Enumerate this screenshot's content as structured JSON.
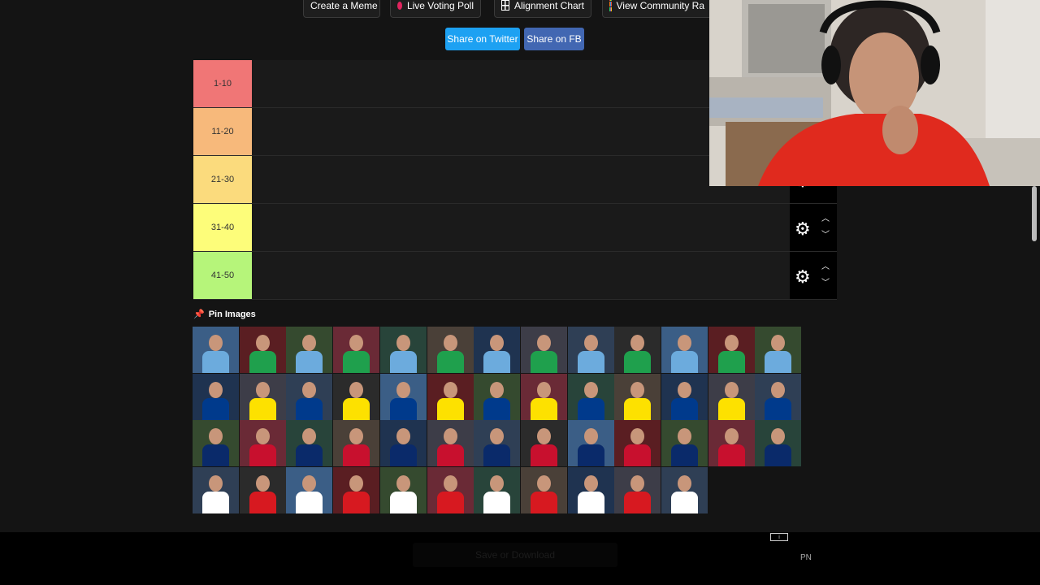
{
  "toolbar": {
    "create_meme": "Create a Meme",
    "live_voting": "Live Voting Poll",
    "alignment": "Alignment Chart",
    "community": "View Community Ra"
  },
  "share": {
    "twitter": "Share on Twitter",
    "fb": "Share on FB"
  },
  "tiers": [
    {
      "label": "1-10",
      "color": "#f07676"
    },
    {
      "label": "11-20",
      "color": "#f7b97b"
    },
    {
      "label": "21-30",
      "color": "#fbdb7d"
    },
    {
      "label": "31-40",
      "color": "#fdfd7a"
    },
    {
      "label": "41-50",
      "color": "#b6f57a"
    }
  ],
  "pin_label": "Pin Images",
  "save_label": "Save or Download",
  "footer_badge": "PN",
  "ad_icon": "i",
  "colors": {
    "twitter": "#1da1f2",
    "fb": "#4267b2",
    "accent": "#e0245e"
  }
}
